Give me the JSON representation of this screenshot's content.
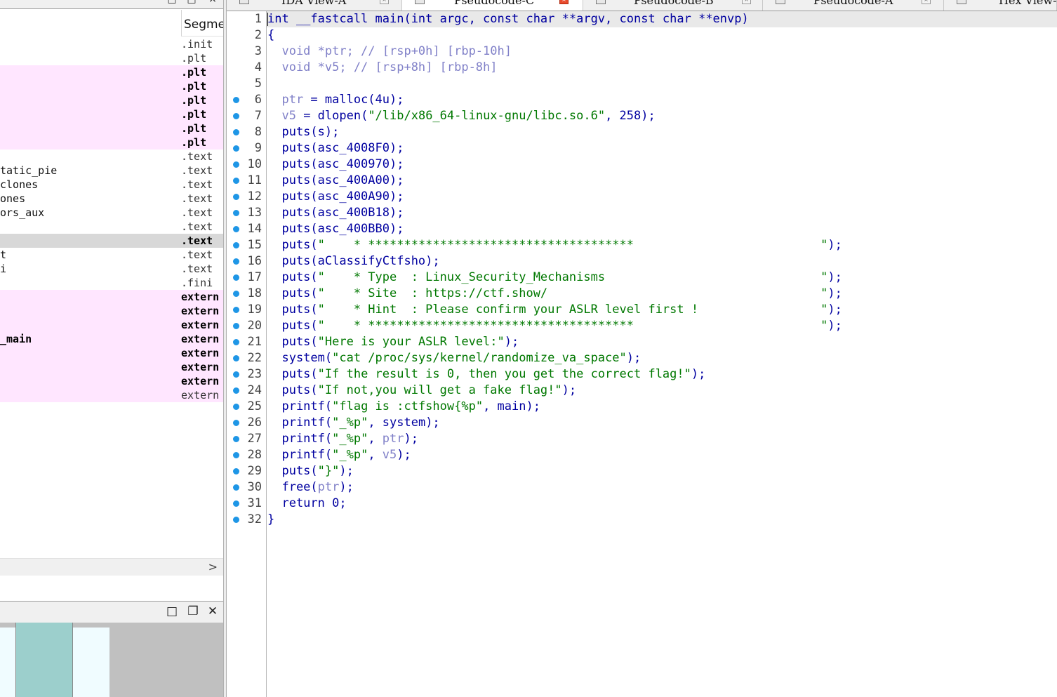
{
  "left_pane": {
    "segment_header": "Segme",
    "functions": [
      {
        "name": "",
        "segment": ".init",
        "style": "normal"
      },
      {
        "name": "",
        "segment": ".plt",
        "style": "normal"
      },
      {
        "name": "",
        "segment": ".plt",
        "style": "pink-bold"
      },
      {
        "name": "",
        "segment": ".plt",
        "style": "pink-bold"
      },
      {
        "name": "",
        "segment": ".plt",
        "style": "pink-bold"
      },
      {
        "name": "",
        "segment": ".plt",
        "style": "pink-bold"
      },
      {
        "name": "",
        "segment": ".plt",
        "style": "pink-bold"
      },
      {
        "name": "",
        "segment": ".plt",
        "style": "pink-bold"
      },
      {
        "name": "",
        "segment": ".text",
        "style": "normal"
      },
      {
        "name": "tatic_pie",
        "segment": ".text",
        "style": "normal"
      },
      {
        "name": "clones",
        "segment": ".text",
        "style": "normal"
      },
      {
        "name": "ones",
        "segment": ".text",
        "style": "normal"
      },
      {
        "name": "ors_aux",
        "segment": ".text",
        "style": "normal"
      },
      {
        "name": "",
        "segment": ".text",
        "style": "normal"
      },
      {
        "name": "",
        "segment": ".text",
        "style": "selected-bold"
      },
      {
        "name": "t",
        "segment": ".text",
        "style": "normal"
      },
      {
        "name": "i",
        "segment": ".text",
        "style": "normal"
      },
      {
        "name": "",
        "segment": ".fini",
        "style": "normal"
      },
      {
        "name": "",
        "segment": "extern",
        "style": "pink-bold"
      },
      {
        "name": "",
        "segment": "extern",
        "style": "pink-bold"
      },
      {
        "name": "",
        "segment": "extern",
        "style": "pink-bold"
      },
      {
        "name": "_main",
        "segment": "extern",
        "style": "pink-bold"
      },
      {
        "name": "",
        "segment": "extern",
        "style": "pink-bold"
      },
      {
        "name": "",
        "segment": "extern",
        "style": "pink-bold"
      },
      {
        "name": "",
        "segment": "extern",
        "style": "pink-bold"
      },
      {
        "name": "",
        "segment": "extern",
        "style": "pink"
      }
    ],
    "scroll_right_icon": "chevron-right-icon",
    "minimap_buttons": [
      "maximize-icon",
      "restore-icon",
      "close-icon"
    ]
  },
  "tabs": [
    {
      "label": "IDA View-A",
      "active": false
    },
    {
      "label": "Pseudocode-C",
      "active": true
    },
    {
      "label": "Pseudocode-B",
      "active": false
    },
    {
      "label": "Pseudocode-A",
      "active": false
    },
    {
      "label": "Hex View-",
      "active": false
    }
  ],
  "code_lines": [
    {
      "n": "1",
      "dot": false,
      "tokens": [
        [
          "k",
          "int __fastcall main(int argc, const char **argv, const char **envp)"
        ]
      ]
    },
    {
      "n": "2",
      "dot": false,
      "tokens": [
        [
          "k",
          "{"
        ]
      ]
    },
    {
      "n": "3",
      "dot": false,
      "tokens": [
        [
          "g",
          "  void *ptr; // [rsp+0h] [rbp-10h]"
        ]
      ]
    },
    {
      "n": "4",
      "dot": false,
      "tokens": [
        [
          "g",
          "  void *v5; // [rsp+8h] [rbp-8h]"
        ]
      ]
    },
    {
      "n": "5",
      "dot": false,
      "tokens": [
        [
          "k",
          ""
        ]
      ]
    },
    {
      "n": "6",
      "dot": true,
      "tokens": [
        [
          "g",
          "  ptr"
        ],
        [
          "k",
          " = malloc(4u);"
        ]
      ]
    },
    {
      "n": "7",
      "dot": true,
      "tokens": [
        [
          "g",
          "  v5"
        ],
        [
          "k",
          " = dlopen("
        ],
        [
          "s",
          "\"/lib/x86_64-linux-gnu/libc.so.6\""
        ],
        [
          "k",
          ", 258);"
        ]
      ]
    },
    {
      "n": "8",
      "dot": true,
      "tokens": [
        [
          "k",
          "  puts(s);"
        ]
      ]
    },
    {
      "n": "9",
      "dot": true,
      "tokens": [
        [
          "k",
          "  puts(asc_4008F0);"
        ]
      ]
    },
    {
      "n": "10",
      "dot": true,
      "tokens": [
        [
          "k",
          "  puts(asc_400970);"
        ]
      ]
    },
    {
      "n": "11",
      "dot": true,
      "tokens": [
        [
          "k",
          "  puts(asc_400A00);"
        ]
      ]
    },
    {
      "n": "12",
      "dot": true,
      "tokens": [
        [
          "k",
          "  puts(asc_400A90);"
        ]
      ]
    },
    {
      "n": "13",
      "dot": true,
      "tokens": [
        [
          "k",
          "  puts(asc_400B18);"
        ]
      ]
    },
    {
      "n": "14",
      "dot": true,
      "tokens": [
        [
          "k",
          "  puts(asc_400BB0);"
        ]
      ]
    },
    {
      "n": "15",
      "dot": true,
      "tokens": [
        [
          "k",
          "  puts("
        ],
        [
          "s",
          "\"    * *************************************                          \""
        ],
        [
          "k",
          ");"
        ]
      ]
    },
    {
      "n": "16",
      "dot": true,
      "tokens": [
        [
          "k",
          "  puts(aClassifyCtfsho);"
        ]
      ]
    },
    {
      "n": "17",
      "dot": true,
      "tokens": [
        [
          "k",
          "  puts("
        ],
        [
          "s",
          "\"    * Type  : Linux_Security_Mechanisms                              \""
        ],
        [
          "k",
          ");"
        ]
      ]
    },
    {
      "n": "18",
      "dot": true,
      "tokens": [
        [
          "k",
          "  puts("
        ],
        [
          "s",
          "\"    * Site  : https://ctf.show/                                      \""
        ],
        [
          "k",
          ");"
        ]
      ]
    },
    {
      "n": "19",
      "dot": true,
      "tokens": [
        [
          "k",
          "  puts("
        ],
        [
          "s",
          "\"    * Hint  : Please confirm your ASLR level first !                 \""
        ],
        [
          "k",
          ");"
        ]
      ]
    },
    {
      "n": "20",
      "dot": true,
      "tokens": [
        [
          "k",
          "  puts("
        ],
        [
          "s",
          "\"    * *************************************                          \""
        ],
        [
          "k",
          ");"
        ]
      ]
    },
    {
      "n": "21",
      "dot": true,
      "tokens": [
        [
          "k",
          "  puts("
        ],
        [
          "s",
          "\"Here is your ASLR level:\""
        ],
        [
          "k",
          ");"
        ]
      ]
    },
    {
      "n": "22",
      "dot": true,
      "tokens": [
        [
          "k",
          "  system("
        ],
        [
          "s",
          "\"cat /proc/sys/kernel/randomize_va_space\""
        ],
        [
          "k",
          ");"
        ]
      ]
    },
    {
      "n": "23",
      "dot": true,
      "tokens": [
        [
          "k",
          "  puts("
        ],
        [
          "s",
          "\"If the result is 0, then you get the correct flag!\""
        ],
        [
          "k",
          ");"
        ]
      ]
    },
    {
      "n": "24",
      "dot": true,
      "tokens": [
        [
          "k",
          "  puts("
        ],
        [
          "s",
          "\"If not,you will get a fake flag!\""
        ],
        [
          "k",
          ");"
        ]
      ]
    },
    {
      "n": "25",
      "dot": true,
      "tokens": [
        [
          "k",
          "  printf("
        ],
        [
          "s",
          "\"flag is :ctfshow{%p\""
        ],
        [
          "k",
          ", main);"
        ]
      ]
    },
    {
      "n": "26",
      "dot": true,
      "tokens": [
        [
          "k",
          "  printf("
        ],
        [
          "s",
          "\"_%p\""
        ],
        [
          "k",
          ", system);"
        ]
      ]
    },
    {
      "n": "27",
      "dot": true,
      "tokens": [
        [
          "k",
          "  printf("
        ],
        [
          "s",
          "\"_%p\""
        ],
        [
          "k",
          ", "
        ],
        [
          "g",
          "ptr"
        ],
        [
          "k",
          ");"
        ]
      ]
    },
    {
      "n": "28",
      "dot": true,
      "tokens": [
        [
          "k",
          "  printf("
        ],
        [
          "s",
          "\"_%p\""
        ],
        [
          "k",
          ", "
        ],
        [
          "g",
          "v5"
        ],
        [
          "k",
          ");"
        ]
      ]
    },
    {
      "n": "29",
      "dot": true,
      "tokens": [
        [
          "k",
          "  puts("
        ],
        [
          "s",
          "\"}\""
        ],
        [
          "k",
          ");"
        ]
      ]
    },
    {
      "n": "30",
      "dot": true,
      "tokens": [
        [
          "k",
          "  free("
        ],
        [
          "g",
          "ptr"
        ],
        [
          "k",
          ");"
        ]
      ]
    },
    {
      "n": "31",
      "dot": true,
      "tokens": [
        [
          "k",
          "  return 0;"
        ]
      ]
    },
    {
      "n": "32",
      "dot": true,
      "tokens": [
        [
          "k",
          "}"
        ]
      ]
    }
  ],
  "colors": {
    "keyword": "#0000a0",
    "string": "#007800",
    "variable": "#8080c8",
    "breakpoint_dot": "#1e96e6",
    "pink_row": "#ffe6ff",
    "selected_row": "#d8d8d8",
    "active_tab_close": "#e84a2c"
  }
}
